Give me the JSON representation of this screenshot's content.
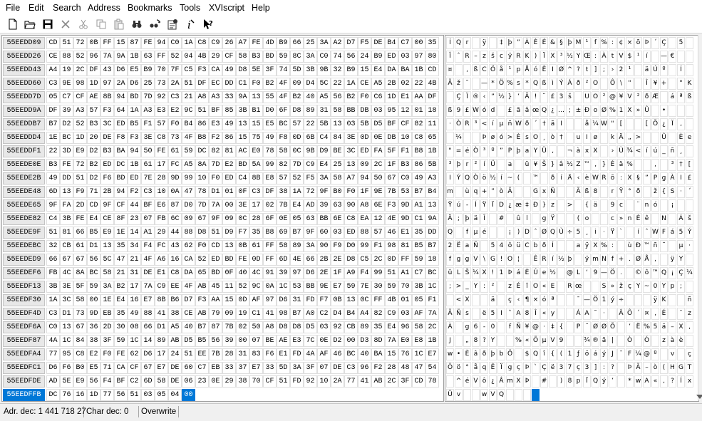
{
  "menu": [
    "File",
    "Edit",
    "Search",
    "Address",
    "Bookmarks",
    "Tools",
    "XVIscript",
    "Help"
  ],
  "toolbar": {
    "buttons": [
      {
        "name": "new-file-button",
        "icon": "new-file-icon"
      },
      {
        "name": "open-file-button",
        "icon": "open-folder-icon"
      },
      {
        "name": "save-button",
        "icon": "floppy-disk-icon"
      },
      {
        "name": "close-file-button",
        "icon": "close-icon"
      },
      {
        "name": "cut-button",
        "icon": "scissors-icon"
      },
      {
        "name": "copy-button",
        "icon": "copy-icon"
      },
      {
        "name": "paste-button",
        "icon": "paste-icon"
      },
      {
        "name": "find-button",
        "icon": "binoculars-icon"
      },
      {
        "name": "find-replace-button",
        "icon": "find-replace-icon"
      },
      {
        "name": "properties-button",
        "icon": "properties-icon"
      },
      {
        "name": "script-button",
        "icon": "script-icon"
      },
      {
        "name": "context-help-button",
        "icon": "context-help-icon"
      }
    ]
  },
  "hex": {
    "rows": [
      {
        "addr": "55EEDD09",
        "bytes": "CD 51 72 0B FF 15 87 FE 94 C0 1A C8 C9 26 A7 FE 4D B9 66 25 3A A2 D7 F5 DE B4 C7 00 35",
        "text": "ÍQr ÿ ‡þ”ÀÈÉ&§þM¹f%:¢×õÞ´Ç 5"
      },
      {
        "addr": "55EEDD26",
        "bytes": "CE 88 52 96 7A 9A 1B 63 FF 52 04 4B 29 CF 58 B3 BD 59 8C 3A C0 74 56 24 B9 ED 03 97 80",
        "text": "ÎˆR–zšcÿRK)ÏX³½YŒ:ÀtV$¹í —€"
      },
      {
        "addr": "55EEDD43",
        "bytes": "A4 19 2C DF 43 D6 E5 B9 70 7F C5 F3 CA 49 D8 5E 3F 74 5D 3B 9B 32 B9 15 E4 DA BA 1B CD",
        "text": "¤ ,ßCÖå¹pÅóÊIØ^?t];›2¹ äÚº Í"
      },
      {
        "addr": "55EEDD60",
        "bytes": "C3 9E 98 1D 97 2A D6 25 73 2A 51 DF EC DD C1 F0 B2 4F 09 D4 5C 22 1A CE A5 2B 02 22 4B",
        "text": "Ãž˜ —*Ö%s*QßìÝÁð²O Ô\\\" Î¥+ \"K"
      },
      {
        "addr": "55EEDD7D",
        "bytes": "05 C7 CF AE 8B 94 BD 7D 92 C3 21 A8 A3 33 9A 13 55 4F B2 40 A5 56 B2 F0 C6 1D E1 AA DF",
        "text": " ÇÏ®‹”½}’Ã!¨£3š UO²@¥V²ðÆ áªß"
      },
      {
        "addr": "55EEDD9A",
        "bytes": "DF 39 A3 57 F3 64 1A A3 E3 E2 9C 51 BF 85 3B B1 D0 6F D8 89 31 58 BB DB 03 95 12 01 18",
        "text": "ß9£Wód £ãâœQ¿…;±ÐoØ‰1X»Û •   "
      },
      {
        "addr": "55EEDDB7",
        "bytes": "B7 D2 52 B3 3C ED B5 F1 57 F0 B4 86 E3 49 13 15 E5 BC 57 22 5B 13 03 5B D5 BF CF 82 11",
        "text": "·ÒR³<íµñWð´†ãI  å¼W\"[  [Õ¿Ï‚ "
      },
      {
        "addr": "55EEDDD4",
        "bytes": "1E BC 1D 20 DE F8 F3 3E C8 73 4F B8 F2 86 15 75 49 F8 0D 6B C4 84 3E 0D 0E DB 10 C8 65",
        "text": " ¼  Þøó>ÈsO¸ò† uIø kÄ„>  Û Èe"
      },
      {
        "addr": "55EEDDF1",
        "bytes": "22 3D E9 D2 B3 BA 94 50 FE 61 59 DC 82 81 AC E0 78 58 0C 9B D9 BE 3C ED FA 5F F1 B8 1B",
        "text": "\"=éÒ³º”PþaYÜ‚ ¬àxX ›Ù¾<íú_ñ¸ "
      },
      {
        "addr": "55EEDE0E",
        "bytes": "B3 FE 72 B2 ED DC 1B 61 17 FC A5 8A 7D E2 BD 5A 99 82 7D C9 E4 25 13 09 2C 1F B3 86 5B",
        "text": "³þr²íÜ a ü¥Š}â½Z™‚}Éä%  , ³†["
      },
      {
        "addr": "55EEDE2B",
        "bytes": "49 DD 51 D2 F6 BD ED 7E 28 9D 99 10 F0 ED C4 8B E8 57 52 F5 3A 58 A7 94 50 67 C0 49 A3",
        "text": "IÝQÒö½í~( ™ ðíÄ‹èWRõ:X§”PgÀI£"
      },
      {
        "addr": "55EEDE48",
        "bytes": "6D 13 F9 71 2B 94 F2 C3 10 0A 47 78 D1 01 0F C3 DF 38 1A 72 9F B0 F0 1F 9E 7B 53 B7 B4",
        "text": "m ùq+”òÃ  GxÑ  Ãß8 rŸ°ð ž{S·´"
      },
      {
        "addr": "55EEDE65",
        "bytes": "9F FA 2D CD 9F CF 44 BF E6 87 D0 7D 7A 00 3E 17 02 7B E4 AD 39 63 90 A8 6E F3 9D A1 13",
        "text": "Ÿú-ÍŸÏD¿æ‡Ð}z > {ä­9c ¨nó ¡ "
      },
      {
        "addr": "55EEDE82",
        "bytes": "C4 3B FE E4 CE 8F 23 07 FB 6C 09 67 9F 09 0C 28 6F 0E 05 63 BB 6E C8 EA 12 4E 9D C1 9A",
        "text": "Ä;þäÎ # ûl gŸ  (o  c»nÈê N Áš"
      },
      {
        "addr": "55EEDE9F",
        "bytes": "51 81 66 B5 E9 1E 14 A1 29 44 88 D8 51 D9 F7 35 B8 69 B7 9F 60 03 ED 88 57 46 E1 35 DD",
        "text": "Q fµé  ¡)DˆØQÙ÷5¸i·Ÿ` íˆWFá5Ý"
      },
      {
        "addr": "55EEDEBC",
        "bytes": "32 CB 61 D1 13 35 34 F4 FC 43 62 F0 CD 13 0B 61 FF 58 89 3A 90 F9 D0 99 F1 98 81 B5 B7",
        "text": "2ËaÑ 54ôüCbðÍ  aÿX‰: ùÐ™ñ˜ µ·"
      },
      {
        "addr": "55EEDED9",
        "bytes": "66 67 67 56 5C 47 21 4F A6 16 CA 52 ED BD FE 0D FF 6D 4E 66 2B 2E D8 C5 2C 0D FF 59 18",
        "text": "fggV\\G!O¦ ÊRí½þ ÿmNf+.ØÅ, ÿY "
      },
      {
        "addr": "55EEDEF6",
        "bytes": "FB 4C 8A BC 58 21 31 DE E1 C8 DA 65 BD 0F 40 4C 91 39 97 D6 2E 1F A9 F4 99 51 A1 C7 BC",
        "text": "ûLŠ¼X!1ÞáÈÚe½ @L‘9—Ö. ©ô™Q¡Ç¼"
      },
      {
        "addr": "55EEDF13",
        "bytes": "3B 3E 5F 59 3A B2 17 7A C9 EE 4F AB 45 11 52 9C 0A 1C 53 BB 9E E7 59 7E 30 59 70 3B 1C",
        "text": ";>_Y:² zÉîO«E Rœ  S»žçY~0Yp; "
      },
      {
        "addr": "55EEDF30",
        "bytes": "1A 3C 58 00 1E E4 16 E7 8B B6 D7 F3 AA 15 0D AF 97 D6 31 FD F7 0B 13 0C FF 4B 01 05 F1",
        "text": " <X  ä ç‹¶×óª  ¯—Ö1ý÷   ÿK  ñ"
      },
      {
        "addr": "55EEDF4D",
        "bytes": "C3 D1 73 9D EB 35 49 88 41 38 CE AB 79 09 19 C1 41 98 B7 A0 C2 D4 B4 A4 82 C9 03 AF 7A",
        "text": "ÃÑs ë5IˆA8Î«y  ÁA˜· ÂÔ´¤‚É ¯z"
      },
      {
        "addr": "55EEDF6A",
        "bytes": "C0 13 67 36 2D 30 08 66 D1 A5 40 B7 87 7B 02 50 A8 D8 D8 D5 03 92 CB 89 35 E4 96 58 2C",
        "text": "À g6-0 fÑ¥@·‡{ P¨ØØÕ ’Ë‰5ä–X,"
      },
      {
        "addr": "55EEDF87",
        "bytes": "4A 1C 84 38 3F 59 1C 14 89 AB D5 B5 56 39 00 07 BE AE E3 7C 0E D2 00 D3 8D 7A E0 E8 1B",
        "text": "J „8?Y  ‰«ÕµV9  ¾®ã| Ò Ó zàè "
      },
      {
        "addr": "55EEDFA4",
        "bytes": "77 95 C8 E2 F0 FE 62 D6 17 24 51 EE 7B 28 31 83 F6 E1 FD 4A AF 46 BC 40 BA 15 76 1C E7",
        "text": "w•ÈâðþbÖ $Qî{(1ƒöáýJ¯F¼@º v ç"
      },
      {
        "addr": "55EEDFC1",
        "bytes": "D6 F6 B0 E5 71 CA CF 67 E7 DE 60 C7 EB 33 37 E7 33 5D 3A 3F 07 DE C3 96 F2 28 48 47 54",
        "text": "Öö°åqÊÏgçÞ`Çë37ç3]:? ÞÃ–ò(HGT"
      },
      {
        "addr": "55EEDFDE",
        "bytes": "AD 5E E9 56 F4 BF C2 6D 58 DE 06 23 0E 29 38 70 CF 51 FD 92 10 2A 77 41 AB 2C 3F CD 78",
        "text": "­^éVô¿ÂmXÞ # )8pÏQý’ *wA«,?Íx"
      },
      {
        "addr": "55EEDFFB",
        "bytes": "DC 76 16 1D 77 56 51 03 05 04 00",
        "text": "Üv  wVQ   ",
        "selected": true,
        "cursor_index": 10
      }
    ]
  },
  "status": {
    "address": "Adr. dec: 1 441 718 27",
    "char": "Char dec: 0",
    "mode": "Overwrite"
  }
}
